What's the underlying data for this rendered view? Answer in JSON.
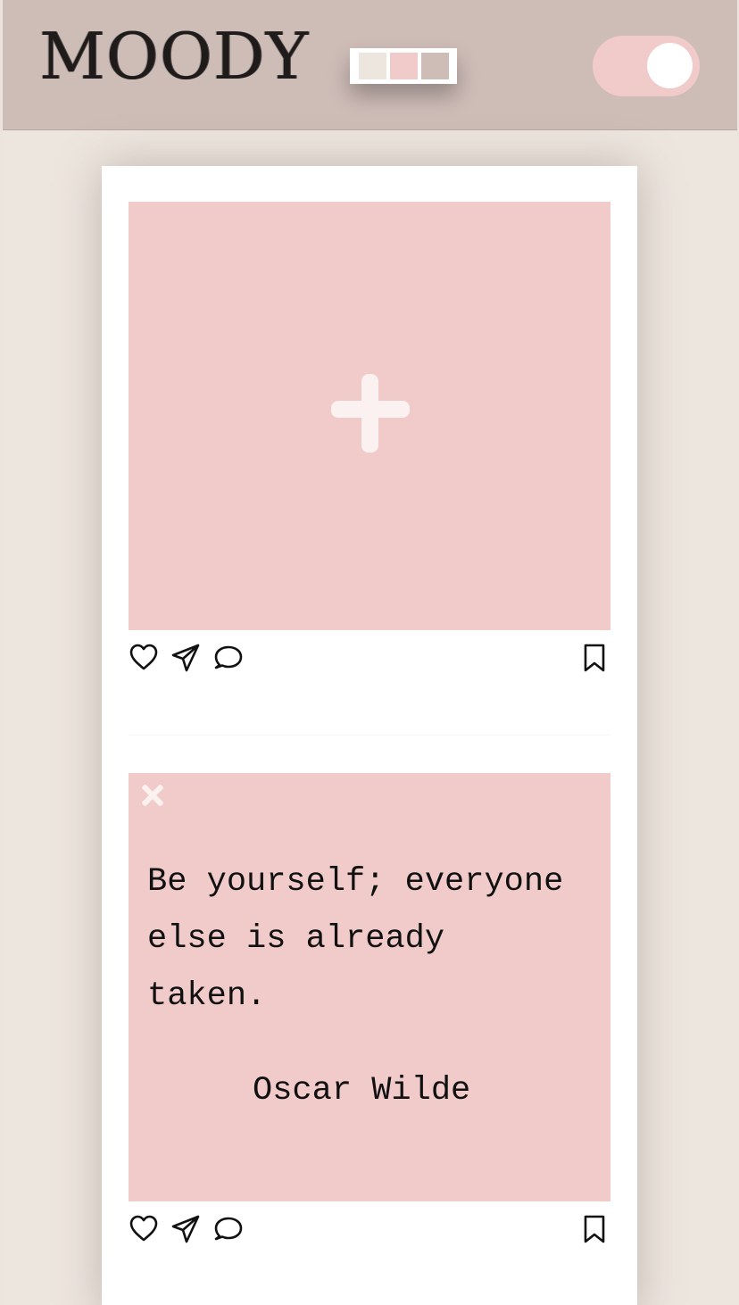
{
  "header": {
    "logo_text": "MOODY",
    "palette": [
      "#ede6df",
      "#f0cbca",
      "#cebcb7"
    ],
    "toggle": {
      "state": "on",
      "track_color": "#f0cbca",
      "knob_color": "#ffffff"
    },
    "background": "#cebcb7"
  },
  "feed": {
    "background": "#ffffff",
    "posts": [
      {
        "type": "empty",
        "add_icon": "plus-icon",
        "tile_color": "#f0cbca",
        "actions": [
          "heart-icon",
          "send-icon",
          "comment-icon",
          "bookmark-icon"
        ]
      },
      {
        "type": "quote",
        "close_icon": "close-icon",
        "quote": "Be yourself; everyone else is already taken.",
        "author": "Oscar Wilde",
        "tile_color": "#f0cbca",
        "actions": [
          "heart-icon",
          "send-icon",
          "comment-icon",
          "bookmark-icon"
        ]
      }
    ]
  },
  "colors": {
    "page_background": "#ede6df",
    "accent_pink": "#f0cbca",
    "text": "#111111"
  }
}
